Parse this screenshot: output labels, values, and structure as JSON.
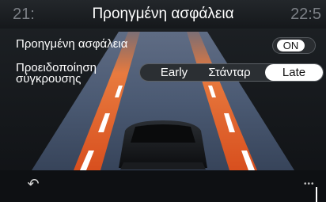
{
  "header": {
    "title": "Προηγμένη ασφάλεια",
    "clock_left": "21:",
    "clock_right": "22:5"
  },
  "settings": {
    "advanced_safety": {
      "label": "Προηγμένη ασφάλεια",
      "toggle_value": "ON"
    },
    "collision_warning": {
      "label_line1": "Προειδοποίηση",
      "label_line2": "σύγκρουσης",
      "options": [
        "Early",
        "Στάνταρ",
        "Late"
      ],
      "selected": "Late"
    }
  },
  "footer": {
    "back_icon": "back-arrow-icon",
    "more_icon": "more-dots-icon"
  },
  "colors": {
    "lane_orange": "#e8642a",
    "lane_white": "#ffffff",
    "background": "#0d0f12"
  }
}
